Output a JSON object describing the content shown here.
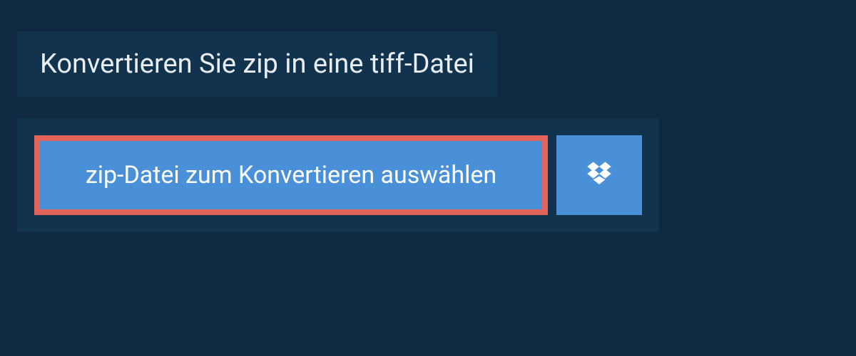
{
  "header": {
    "title": "Konvertieren Sie zip in eine tiff-Datei"
  },
  "actions": {
    "select_file_label": "zip-Datei zum Konvertieren auswählen",
    "dropbox_icon": "dropbox-icon"
  },
  "colors": {
    "background": "#0f2940",
    "panel": "#12334e",
    "button": "#4a90d9",
    "highlight_border": "#e16359",
    "text_light": "#e8eef3"
  }
}
